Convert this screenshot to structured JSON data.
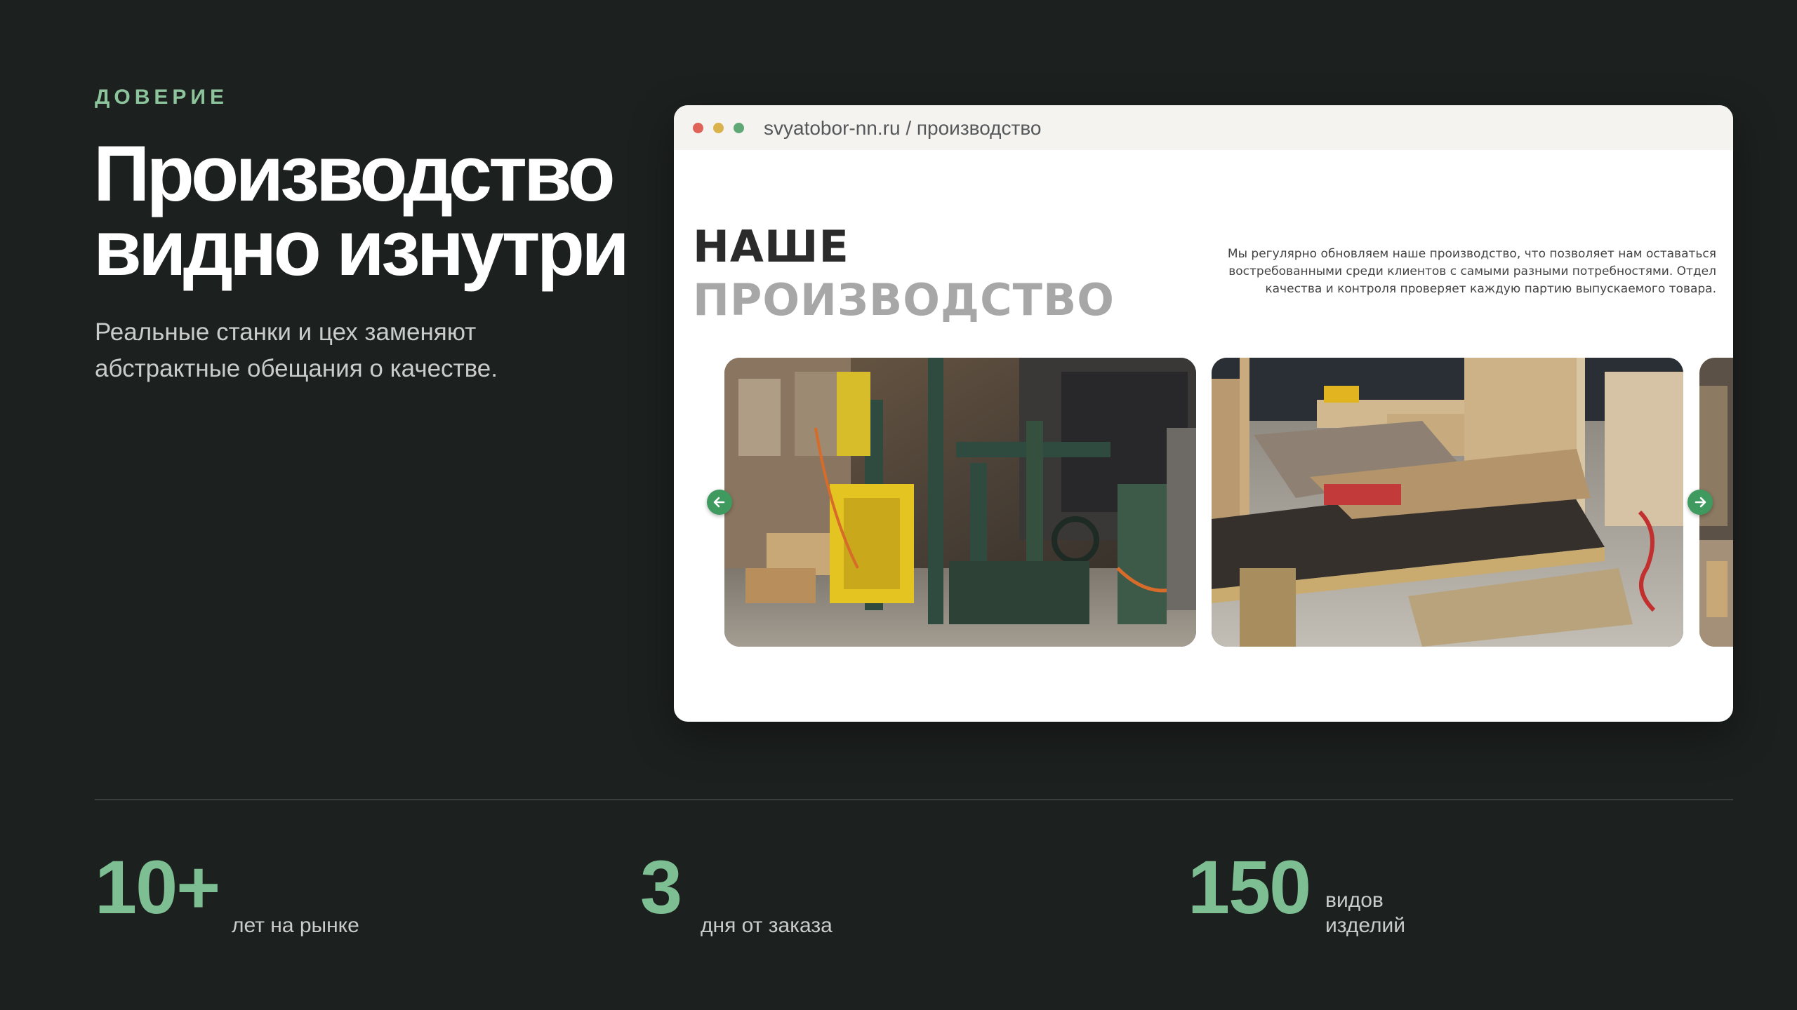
{
  "hero": {
    "eyebrow": "ДОВЕРИЕ",
    "title_line1": "Производство",
    "title_line2": "видно изнутри",
    "subtitle_line1": "Реальные станки и цех заменяют",
    "subtitle_line2": "абстрактные обещания о качестве."
  },
  "browser": {
    "url": "svyatobor-nn.ru / производство",
    "dot_colors": [
      "#e0635a",
      "#d9b24c",
      "#5fa774"
    ],
    "site": {
      "title_line1": "НАШЕ",
      "title_line2": "ПРОИЗВОДСТВО",
      "desc_line1": "Мы регулярно обновляем наше производство, что позволяет нам оставаться",
      "desc_line2": "востребованными среди клиентов с самыми разными потребностями. Отдел",
      "desc_line3": "качества и контроля проверяет каждую партию выпускаемого товара."
    },
    "carousel": {
      "prev_icon": "arrow-left-icon",
      "next_icon": "arrow-right-icon",
      "accent": "#3f9a5f"
    }
  },
  "stats": [
    {
      "value": "10+",
      "label_line1": "лет на рынке",
      "label_line2": ""
    },
    {
      "value": "3",
      "label_line1": "дня от заказа",
      "label_line2": ""
    },
    {
      "value": "150",
      "label_line1": "видов",
      "label_line2": "изделий"
    }
  ],
  "colors": {
    "background": "#1c201f",
    "accent_green": "#7dbf92",
    "eyebrow": "#8cc59c"
  }
}
